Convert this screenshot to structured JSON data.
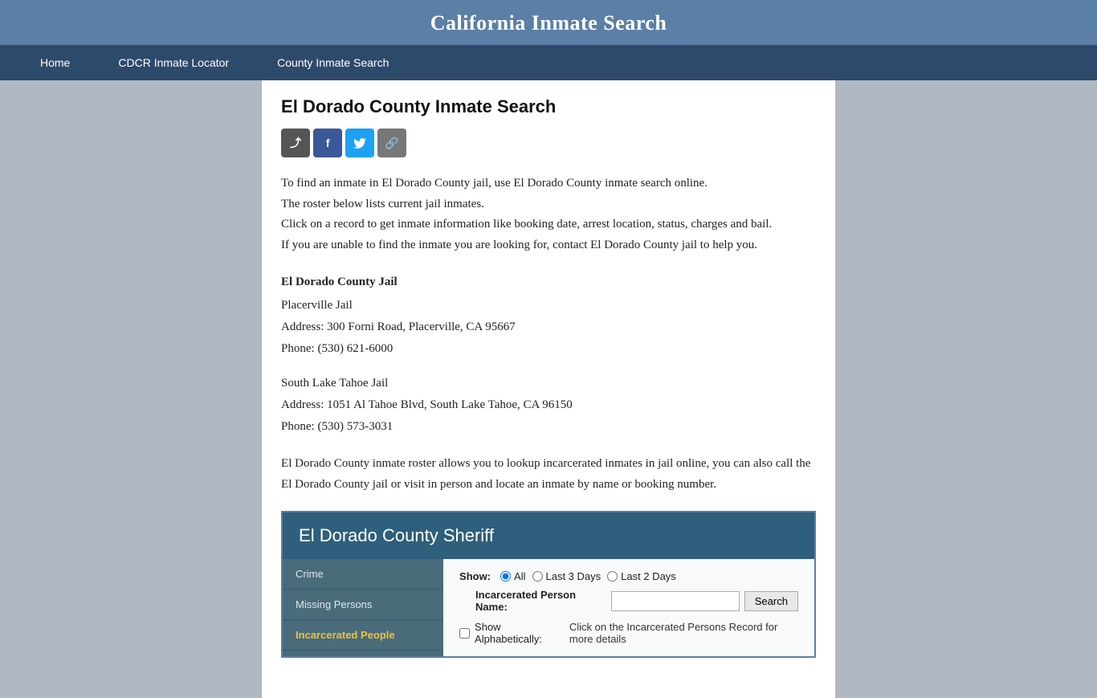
{
  "site": {
    "title": "California Inmate Search"
  },
  "nav": {
    "items": [
      {
        "label": "Home",
        "id": "home"
      },
      {
        "label": "CDCR Inmate Locator",
        "id": "cdcr"
      },
      {
        "label": "County Inmate Search",
        "id": "county"
      }
    ]
  },
  "page": {
    "heading": "El Dorado County Inmate Search",
    "description": [
      "To find an inmate in El Dorado County jail, use El Dorado County inmate search online.",
      "The roster below lists current jail inmates.",
      "Click on a record to get inmate information like booking date, arrest location, status, charges and bail.",
      "If you are unable to find the inmate you are looking for, contact El Dorado County jail to help you."
    ],
    "jail_section_title": "El Dorado County Jail",
    "jails": [
      {
        "name": "Placerville Jail",
        "address": "Address: 300 Forni Road, Placerville, CA 95667",
        "phone": "Phone: (530) 621-6000"
      },
      {
        "name": "South Lake Tahoe Jail",
        "address": "Address: 1051 Al Tahoe Blvd, South Lake Tahoe, CA 96150",
        "phone": "Phone: (530) 573-3031"
      }
    ],
    "bottom_description": "El Dorado County inmate roster allows you to lookup incarcerated inmates in jail online, you can also call the El Dorado County jail or visit in person and locate an inmate by name or booking number.",
    "sheriff_widget": {
      "title": "El Dorado County Sheriff",
      "sidebar_items": [
        {
          "label": "Crime",
          "active": false
        },
        {
          "label": "Missing Persons",
          "active": false
        },
        {
          "label": "Incarcerated People",
          "active": true
        }
      ],
      "show_label": "Show:",
      "radio_options": [
        {
          "label": "All",
          "checked": true
        },
        {
          "label": "Last 3 Days",
          "checked": false
        },
        {
          "label": "Last 2 Days",
          "checked": false
        }
      ],
      "name_label": "Incarcerated Person Name:",
      "name_placeholder": "",
      "search_button": "Search",
      "alpha_label": "Show Alphabetically:",
      "alpha_description": "Click on the Incarcerated Persons Record for more details"
    }
  },
  "social": {
    "share_symbol": "⤴",
    "facebook_symbol": "f",
    "twitter_symbol": "t",
    "link_symbol": "🔗"
  }
}
